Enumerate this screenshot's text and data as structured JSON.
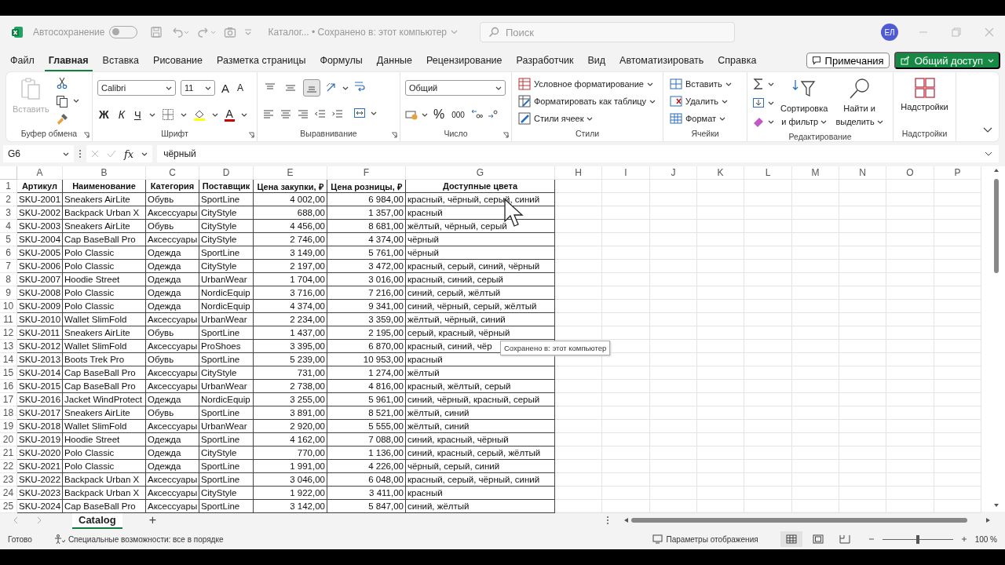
{
  "window": {
    "autosave_label": "Автосохранение",
    "autosave_on": false,
    "title": "Каталог... • Сохранено в: этот компьютер",
    "search_placeholder": "Поиск",
    "avatar": "ЕЛ"
  },
  "menu_tabs": [
    {
      "label": "Файл",
      "selected": false
    },
    {
      "label": "Главная",
      "selected": true
    },
    {
      "label": "Вставка",
      "selected": false
    },
    {
      "label": "Рисование",
      "selected": false
    },
    {
      "label": "Разметка страницы",
      "selected": false
    },
    {
      "label": "Формулы",
      "selected": false
    },
    {
      "label": "Данные",
      "selected": false
    },
    {
      "label": "Рецензирование",
      "selected": false
    },
    {
      "label": "Разработчик",
      "selected": false
    },
    {
      "label": "Вид",
      "selected": false
    },
    {
      "label": "Автоматизировать",
      "selected": false
    },
    {
      "label": "Справка",
      "selected": false
    }
  ],
  "comments_button": "Примечания",
  "share_button": "Общий доступ",
  "ribbon": {
    "paste": {
      "label": "Вставить",
      "disabled": true
    },
    "font_name": "Calibri",
    "font_size": "11",
    "grow_font": "A",
    "shrink_font": "A",
    "bold": "Ж",
    "italic": "К",
    "underline": "Ч",
    "font_color": "A",
    "vertical_align": [
      {
        "selected": false
      },
      {
        "selected": false
      },
      {
        "selected": true
      }
    ],
    "number_format": "Общий",
    "percent": "%",
    "thousands": "000",
    "styles": [
      "Условное форматирование",
      "Форматировать как таблицу",
      "Стили ячеек"
    ],
    "cells": [
      "Вставить",
      "Удалить",
      "Формат"
    ],
    "sort": [
      "Сортировка",
      "и фильтр"
    ],
    "find": [
      "Найти и",
      "выделить"
    ],
    "addins": "Надстройки",
    "groups": [
      "Буфер обмена",
      "Шрифт",
      "Выравнивание",
      "Число",
      "Стили",
      "Ячейки",
      "Редактирование",
      "Надстройки"
    ]
  },
  "formula_bar": {
    "name_box": "G6",
    "fx": "fx",
    "formula": "чёрный"
  },
  "sheet": {
    "columns": [
      {
        "letter": "A",
        "kind": "text"
      },
      {
        "letter": "B",
        "kind": "text"
      },
      {
        "letter": "C",
        "kind": "text"
      },
      {
        "letter": "D",
        "kind": "text"
      },
      {
        "letter": "E",
        "kind": "number"
      },
      {
        "letter": "F",
        "kind": "number"
      },
      {
        "letter": "G",
        "kind": "text"
      },
      {
        "letter": "H",
        "kind": "empty"
      },
      {
        "letter": "I",
        "kind": "empty"
      },
      {
        "letter": "J",
        "kind": "empty"
      },
      {
        "letter": "K",
        "kind": "empty"
      },
      {
        "letter": "L",
        "kind": "empty"
      },
      {
        "letter": "M",
        "kind": "empty"
      },
      {
        "letter": "N",
        "kind": "empty"
      },
      {
        "letter": "O",
        "kind": "empty"
      },
      {
        "letter": "P",
        "kind": "empty"
      }
    ],
    "row_numbers": [
      "1",
      "2",
      "3",
      "4",
      "5",
      "6",
      "7",
      "8",
      "9",
      "10",
      "11",
      "12",
      "13",
      "14",
      "15",
      "16",
      "17",
      "18",
      "19",
      "20",
      "21",
      "22",
      "23",
      "24",
      "25"
    ],
    "header": [
      "Артикул",
      "Наименование",
      "Категория",
      "Поставщик",
      "Цена закупки, ₽",
      "Цена розницы, ₽",
      "Доступные цвета"
    ],
    "rows": [
      [
        "SKU-2001",
        "Sneakers AirLite",
        "Обувь",
        "SportLine",
        "4 002,00",
        "6 984,00",
        "красный, чёрный, серый, синий"
      ],
      [
        "SKU-2002",
        "Backpack Urban X",
        "Аксессуары",
        "CityStyle",
        "688,00",
        "1 357,00",
        "красный"
      ],
      [
        "SKU-2003",
        "Sneakers AirLite",
        "Обувь",
        "CityStyle",
        "4 456,00",
        "8 681,00",
        "жёлтый, чёрный, серый"
      ],
      [
        "SKU-2004",
        "Cap BaseBall Pro",
        "Аксессуары",
        "CityStyle",
        "2 746,00",
        "4 374,00",
        "чёрный"
      ],
      [
        "SKU-2005",
        "Polo Classic",
        "Одежда",
        "SportLine",
        "3 149,00",
        "5 761,00",
        "чёрный"
      ],
      [
        "SKU-2006",
        "Polo Classic",
        "Одежда",
        "CityStyle",
        "2 197,00",
        "3 472,00",
        "красный, серый, синий, чёрный"
      ],
      [
        "SKU-2007",
        "Hoodie Street",
        "Одежда",
        "UrbanWear",
        "1 704,00",
        "3 016,00",
        "красный, синий, серый"
      ],
      [
        "SKU-2008",
        "Polo Classic",
        "Одежда",
        "NordicEquip",
        "3 716,00",
        "7 216,00",
        "синий, серый, жёлтый"
      ],
      [
        "SKU-2009",
        "Polo Classic",
        "Одежда",
        "NordicEquip",
        "4 374,00",
        "9 341,00",
        "синий, чёрный, серый, жёлтый"
      ],
      [
        "SKU-2010",
        "Wallet SlimFold",
        "Аксессуары",
        "UrbanWear",
        "2 234,00",
        "3 359,00",
        "жёлтый, чёрный, синий"
      ],
      [
        "SKU-2011",
        "Sneakers AirLite",
        "Обувь",
        "SportLine",
        "1 437,00",
        "2 195,00",
        "серый, красный, чёрный"
      ],
      [
        "SKU-2012",
        "Wallet SlimFold",
        "Аксессуары",
        "ProShoes",
        "3 395,00",
        "6 870,00",
        "красный, синий, чёр"
      ],
      [
        "SKU-2013",
        "Boots Trek Pro",
        "Обувь",
        "SportLine",
        "5 239,00",
        "10 953,00",
        "красный"
      ],
      [
        "SKU-2014",
        "Cap BaseBall Pro",
        "Аксессуары",
        "CityStyle",
        "731,00",
        "1 274,00",
        "жёлтый"
      ],
      [
        "SKU-2015",
        "Cap BaseBall Pro",
        "Аксессуары",
        "UrbanWear",
        "2 738,00",
        "4 816,00",
        "красный, жёлтый, серый"
      ],
      [
        "SKU-2016",
        "Jacket WindProtect",
        "Одежда",
        "NordicEquip",
        "3 255,00",
        "5 961,00",
        "синий, чёрный, красный, серый"
      ],
      [
        "SKU-2017",
        "Sneakers AirLite",
        "Обувь",
        "SportLine",
        "3 891,00",
        "8 521,00",
        "жёлтый, синий"
      ],
      [
        "SKU-2018",
        "Wallet SlimFold",
        "Аксессуары",
        "UrbanWear",
        "2 920,00",
        "5 555,00",
        "жёлтый, синий"
      ],
      [
        "SKU-2019",
        "Hoodie Street",
        "Одежда",
        "SportLine",
        "4 162,00",
        "7 088,00",
        "синий, красный, чёрный"
      ],
      [
        "SKU-2020",
        "Polo Classic",
        "Одежда",
        "CityStyle",
        "770,00",
        "1 136,00",
        "синий, красный, серый, жёлтый"
      ],
      [
        "SKU-2021",
        "Polo Classic",
        "Одежда",
        "SportLine",
        "1 991,00",
        "4 226,00",
        "чёрный, серый, синий"
      ],
      [
        "SKU-2022",
        "Backpack Urban X",
        "Аксессуары",
        "SportLine",
        "3 046,00",
        "6 048,00",
        "красный, серый, чёрный, синий"
      ],
      [
        "SKU-2023",
        "Backpack Urban X",
        "Аксессуары",
        "CityStyle",
        "1 922,00",
        "3 411,00",
        "красный"
      ],
      [
        "SKU-2024",
        "Cap BaseBall Pro",
        "Аксессуары",
        "SportLine",
        "3 142,00",
        "5 847,00",
        "синий, жёлтый"
      ]
    ],
    "tooltip": "Сохранено в: этот компьютер"
  },
  "sheet_tabs": [
    {
      "label": "Catalog",
      "selected": true
    }
  ],
  "add_sheet": "+",
  "status_bar": {
    "ready": "Готово",
    "accessibility": "Специальные возможности: все в порядке",
    "display_settings": "Параметры отображения",
    "views": [
      {
        "selected": true
      },
      {
        "selected": false
      },
      {
        "selected": false
      }
    ],
    "zoom": {
      "level": 0.5,
      "reading": "100 %"
    }
  }
}
